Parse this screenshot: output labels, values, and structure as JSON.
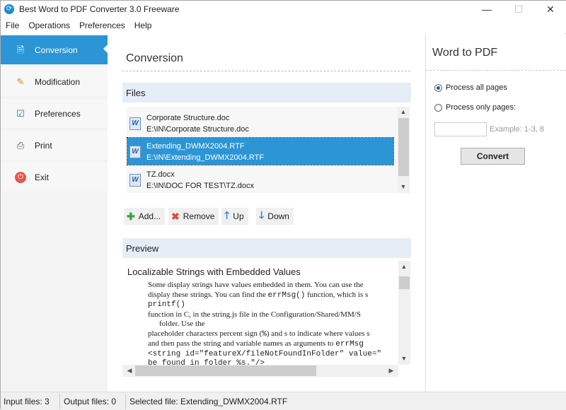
{
  "window": {
    "title": "Best Word to PDF Converter 3.0 Freeware",
    "minimize": "—",
    "maximize": "☐",
    "close": "✕"
  },
  "menu": [
    "File",
    "Operations",
    "Preferences",
    "Help"
  ],
  "sidebar": {
    "items": [
      {
        "label": "Conversion",
        "icon": "convert-icon"
      },
      {
        "label": "Modification",
        "icon": "edit-icon"
      },
      {
        "label": "Preferences",
        "icon": "checklist-icon"
      },
      {
        "label": "Print",
        "icon": "printer-icon"
      },
      {
        "label": "Exit",
        "icon": "power-icon"
      }
    ]
  },
  "main": {
    "title": "Conversion",
    "files_header": "Files",
    "files": [
      {
        "name": "Corporate Structure.doc",
        "path": "E:\\IN\\Corporate Structure.doc"
      },
      {
        "name": "Extending_DWMX2004.RTF",
        "path": "E:\\IN\\Extending_DWMX2004.RTF",
        "selected": true
      },
      {
        "name": "TZ.docx",
        "path": "E:\\IN\\DOC FOR TEST\\TZ.docx"
      }
    ],
    "buttons": {
      "add": "Add...",
      "remove": "Remove",
      "up": "Up",
      "down": "Down"
    },
    "preview_header": "Preview",
    "preview": {
      "heading": "Localizable Strings with Embedded Values",
      "lines": [
        "Some display strings have values embedded in them. You can use the",
        "display these strings. You can find the ",
        "errMsg()",
        " function, which is s",
        "printf()",
        "function in C, in the string.js file in the Configuration/Shared/MM/S",
        "folder. Use the",
        "placeholder characters percent sign (",
        "%",
        ") and s to indicate where values s",
        "and then pass the string and variable names as arguments to ",
        "errMsg",
        "<string id=\"featureX/fileNotFoundInFolder\" value=\"",
        "be found in folder %s.\"/>"
      ]
    }
  },
  "right": {
    "title": "Word to PDF",
    "opt_all": "Process all pages",
    "opt_only": "Process only pages:",
    "pages_value": "",
    "example": "Example: 1-3, 8",
    "convert": "Convert"
  },
  "status": {
    "input": "Input files: 3",
    "output": "Output files: 0",
    "selected": "Selected file: Extending_DWMX2004.RTF"
  }
}
